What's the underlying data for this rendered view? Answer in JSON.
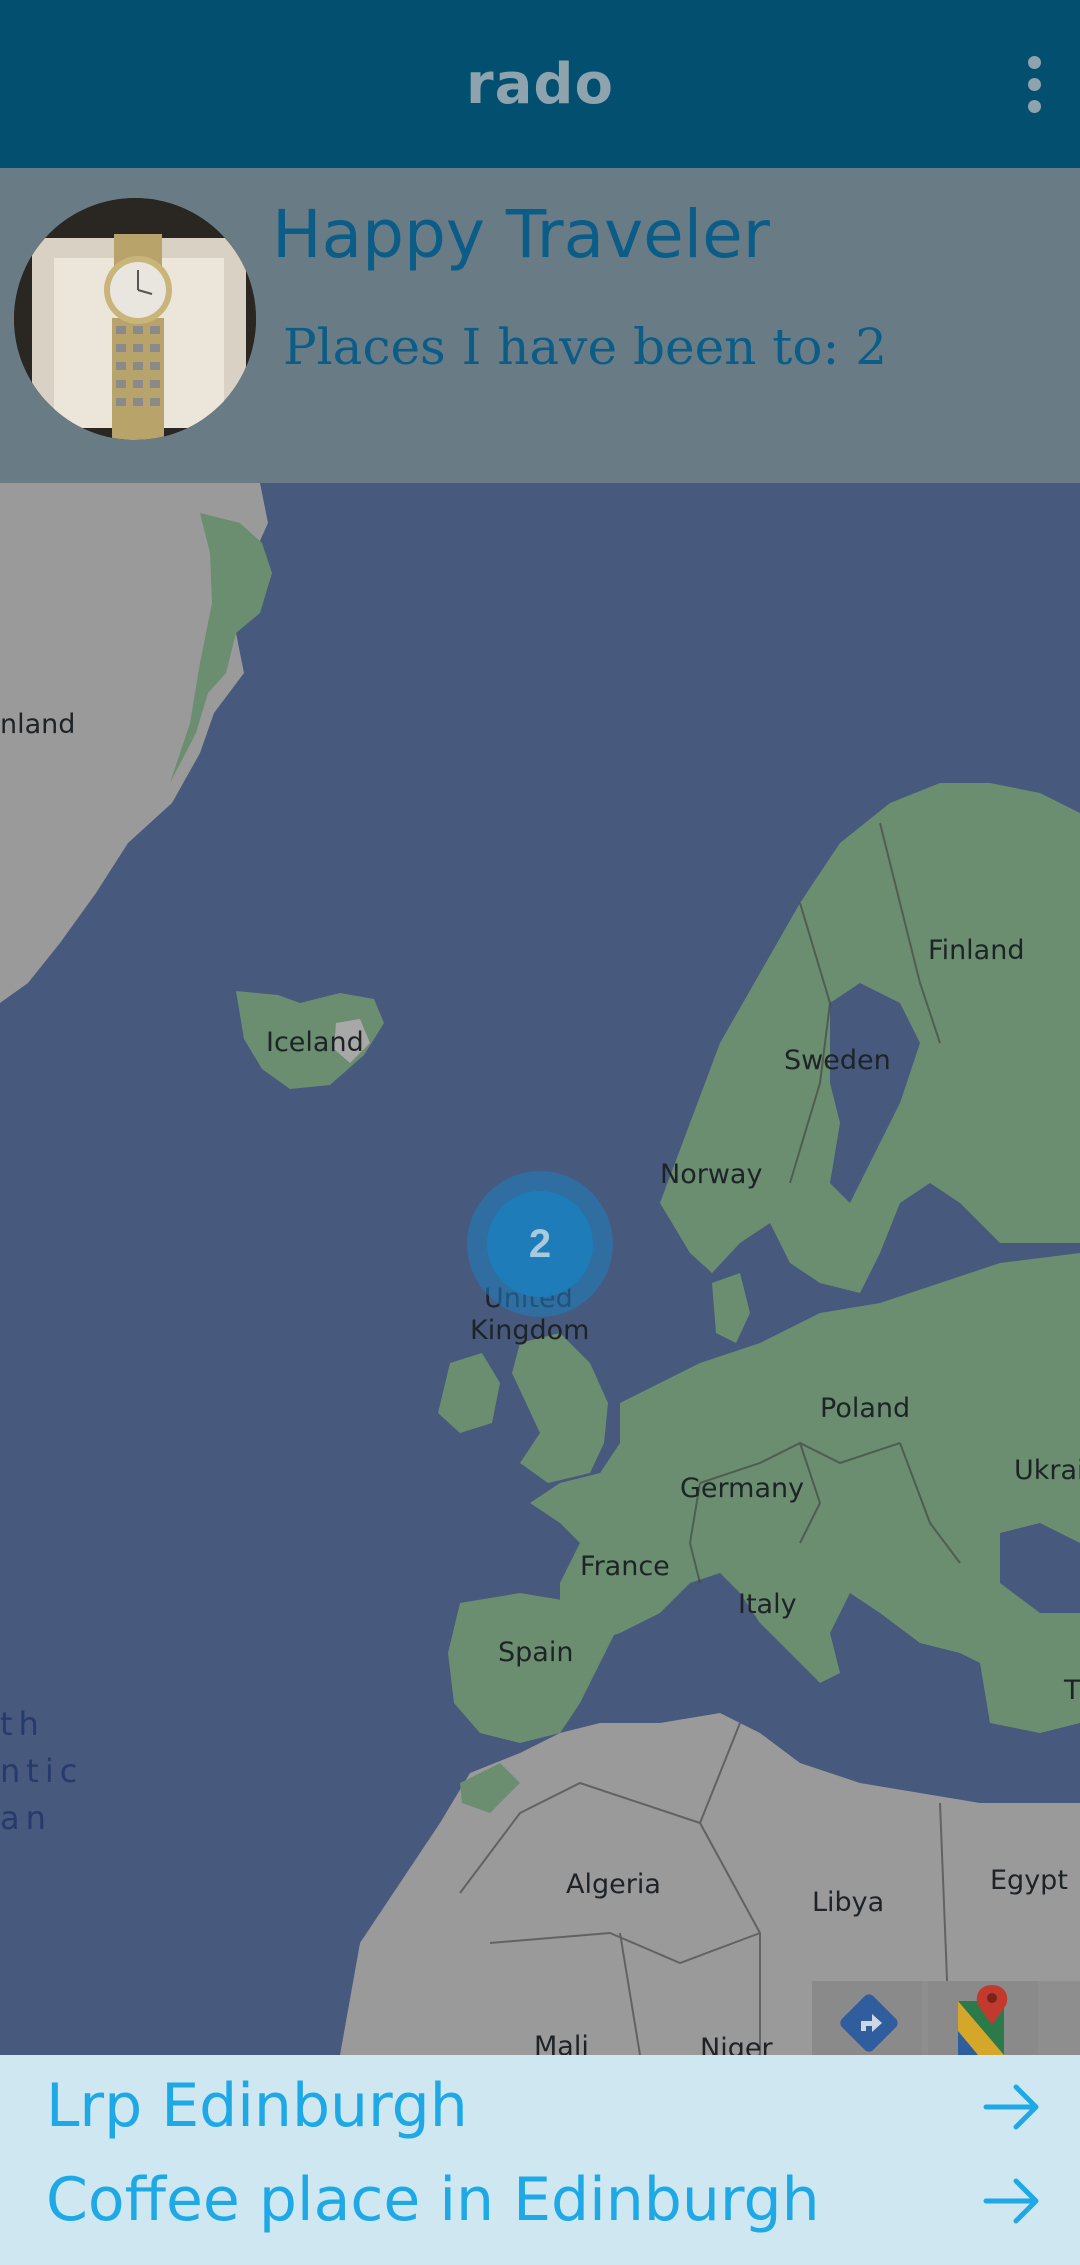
{
  "appbar": {
    "title": "rado",
    "menu_icon": "more-vert-icon"
  },
  "profile": {
    "name": "Happy Traveler",
    "places_text": "Places I have been to: 2",
    "avatar": "avatar-photo-watch"
  },
  "map": {
    "cluster_count": "2",
    "labels": {
      "greenland": "nland",
      "iceland": "Iceland",
      "finland": "Finland",
      "sweden": "Sweden",
      "norway": "Norway",
      "uk_line1": "United",
      "uk_line2": "Kingdom",
      "poland": "Poland",
      "germany": "Germany",
      "ukraine": "Ukrai",
      "france": "France",
      "italy": "Italy",
      "spain": "Spain",
      "turkey": "T",
      "algeria": "Algeria",
      "libya": "Libya",
      "egypt": "Egypt",
      "mali": "Mali",
      "niger": "Niger"
    },
    "ocean_label": "th\nntic\nan",
    "toolbar": {
      "directions_icon": "directions-icon",
      "maps_icon": "google-maps-icon"
    }
  },
  "places": [
    {
      "label": "Lrp Edinburgh",
      "icon": "arrow-right-icon"
    },
    {
      "label": "Coffee place in Edinburgh",
      "icon": "arrow-right-icon"
    }
  ],
  "colors": {
    "appbar": "#024f70",
    "profile_bg": "#697c85",
    "ocean": "#47597d",
    "land_green": "#6b8e70",
    "land_gray": "#9a9a9a",
    "list_bg": "#cfe7f0",
    "list_text": "#1ea9e6"
  }
}
